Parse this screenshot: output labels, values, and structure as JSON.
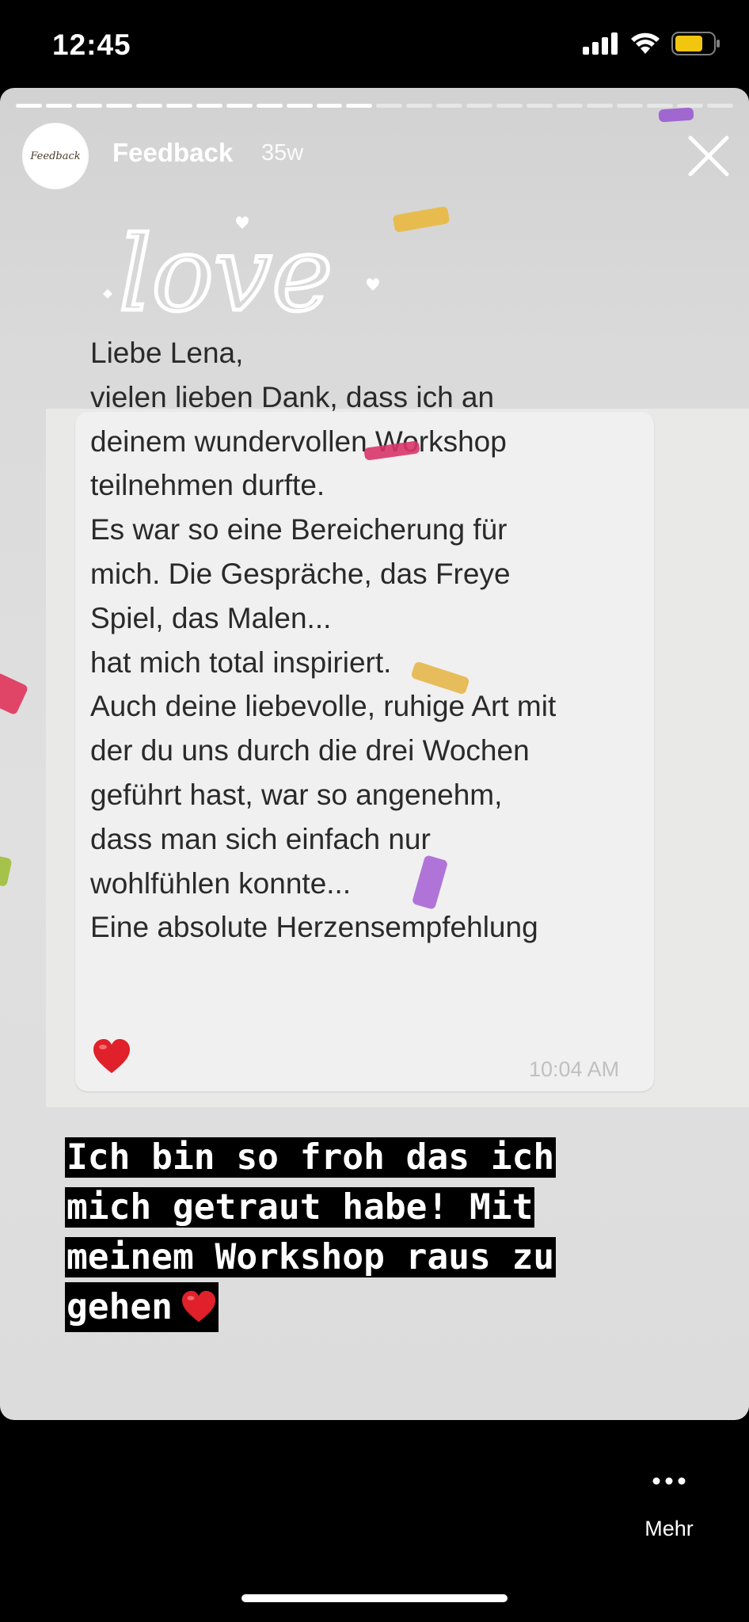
{
  "status_bar": {
    "time": "12:45"
  },
  "story": {
    "username": "Feedback",
    "age": "35w",
    "avatar_label": "Feedback",
    "progress_segments": 24,
    "progress_done": 12,
    "decoration_text": "love",
    "message": {
      "text": "Liebe Lena,\nvielen lieben Dank, dass ich an\ndeinem wundervollen Workshop\nteilnehmen durfte.\nEs war so eine Bereicherung für\nmich. Die Gespräche, das Freye\nSpiel, das Malen...\nhat mich total inspiriert.\nAuch deine liebevolle, ruhige Art mit\nder du uns durch die drei Wochen\ngeführt hast, war so angenehm,\ndass man sich einfach nur\nwohlfühlen konnte...\nEine absolute Herzensempfehlung",
      "time": "10:04 AM"
    },
    "caption_lines": [
      "Ich bin so froh das ich",
      "mich getraut habe! Mit",
      "meinem Workshop raus zu",
      "gehen"
    ]
  },
  "footer": {
    "more_label": "Mehr"
  },
  "colors": {
    "background": "#000000",
    "bubble": "#f0f0f0",
    "heart": "#e0202a"
  }
}
